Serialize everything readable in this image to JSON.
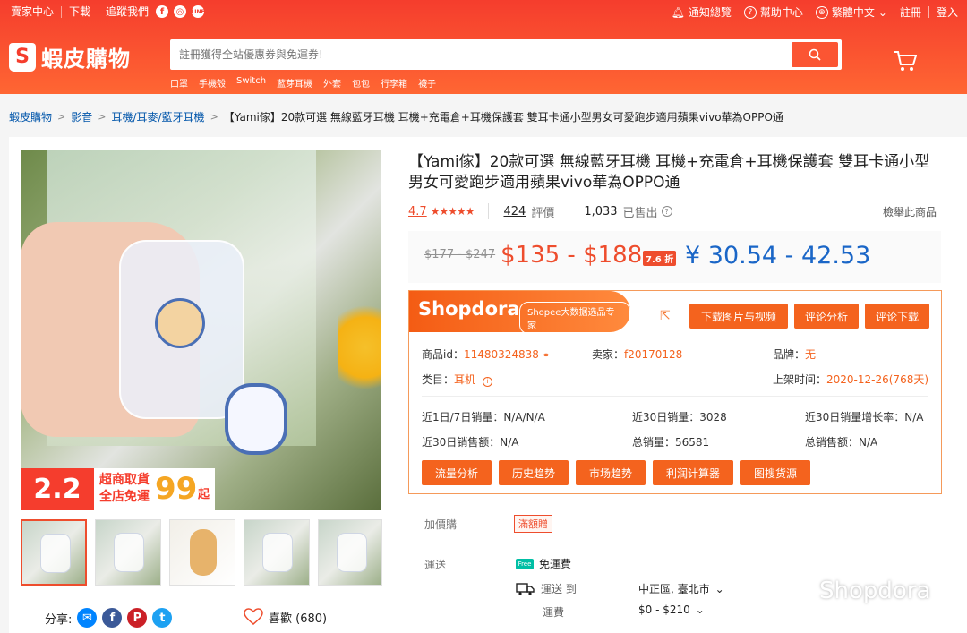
{
  "topbar": {
    "left_links": [
      "賣家中心",
      "下載",
      "追蹤我們"
    ],
    "notifications": "通知總覽",
    "help": "幫助中心",
    "language": "繁體中文",
    "register": "註冊",
    "login": "登入"
  },
  "header": {
    "logo_text": "蝦皮購物",
    "search_placeholder": "註冊獲得全站優惠券與免運券!",
    "hot_keywords": [
      "口罩",
      "手機殼",
      "Switch",
      "藍芽耳機",
      "外套",
      "包包",
      "行李箱",
      "襪子"
    ]
  },
  "breadcrumb": {
    "items": [
      "蝦皮購物",
      "影音",
      "耳機/耳麥/藍牙耳機"
    ],
    "current": "【Yami傢】20款可選 無線藍牙耳機 耳機+充電倉+耳機保護套 雙耳卡通小型男女可愛跑步適用蘋果vivo華為OPPO通"
  },
  "gallery": {
    "promo_big": "2.2",
    "promo_line1": "超商取貨",
    "promo_line2": "全店免運",
    "promo_99": "99",
    "promo_qi": "起"
  },
  "share": {
    "label": "分享:",
    "like_label": "喜歡 (680)"
  },
  "product": {
    "title": "【Yami傢】20款可選 無線藍牙耳機 耳機+充電倉+耳機保護套 雙耳卡通小型男女可愛跑步適用蘋果vivo華為OPPO通",
    "rating": "4.7",
    "stars": 4.7,
    "review_count": "424",
    "review_label": "評價",
    "sold_count": "1,033",
    "sold_label": "已售出",
    "report": "檢舉此商品",
    "old_price": "$177 - $247",
    "price": "$135 - $188",
    "discount": "7.6 折",
    "yen_price": "¥ 30.54 - 42.53"
  },
  "shopdora": {
    "name": "Shopdora",
    "tag": "Shopee大数据选品专家",
    "buttons_top": [
      "下载图片与视频",
      "评论分析",
      "评论下载"
    ],
    "product_id_label": "商品id：",
    "product_id": "11480324838",
    "seller_label": "卖家：",
    "seller": "f20170128",
    "brand_label": "品牌：",
    "brand": "无",
    "category_label": "类目：",
    "category": "耳机",
    "listed_label": "上架时间：",
    "listed": "2020-12-26(768天)",
    "sales_1_7": "近1日/7日销量：N/A/N/A",
    "sales_30": "近30日销量：3028",
    "growth_30": "近30日销量增长率：N/A",
    "revenue_30": "近30日销售额：N/A",
    "total_sales": "总销量：56581",
    "total_revenue": "总销售额：N/A",
    "buttons_bottom": [
      "流量分析",
      "历史趋势",
      "市场趋势",
      "利润计算器",
      "图搜货源"
    ]
  },
  "addon": {
    "label": "加價購",
    "value": "滿額贈"
  },
  "shipping": {
    "label": "運送",
    "free": "免運費",
    "to_label": "運送 到",
    "to_value": "中正區, 臺北市",
    "fee_label": "運費",
    "fee_value": "$0 - $210"
  },
  "watermark": "Shopdora"
}
